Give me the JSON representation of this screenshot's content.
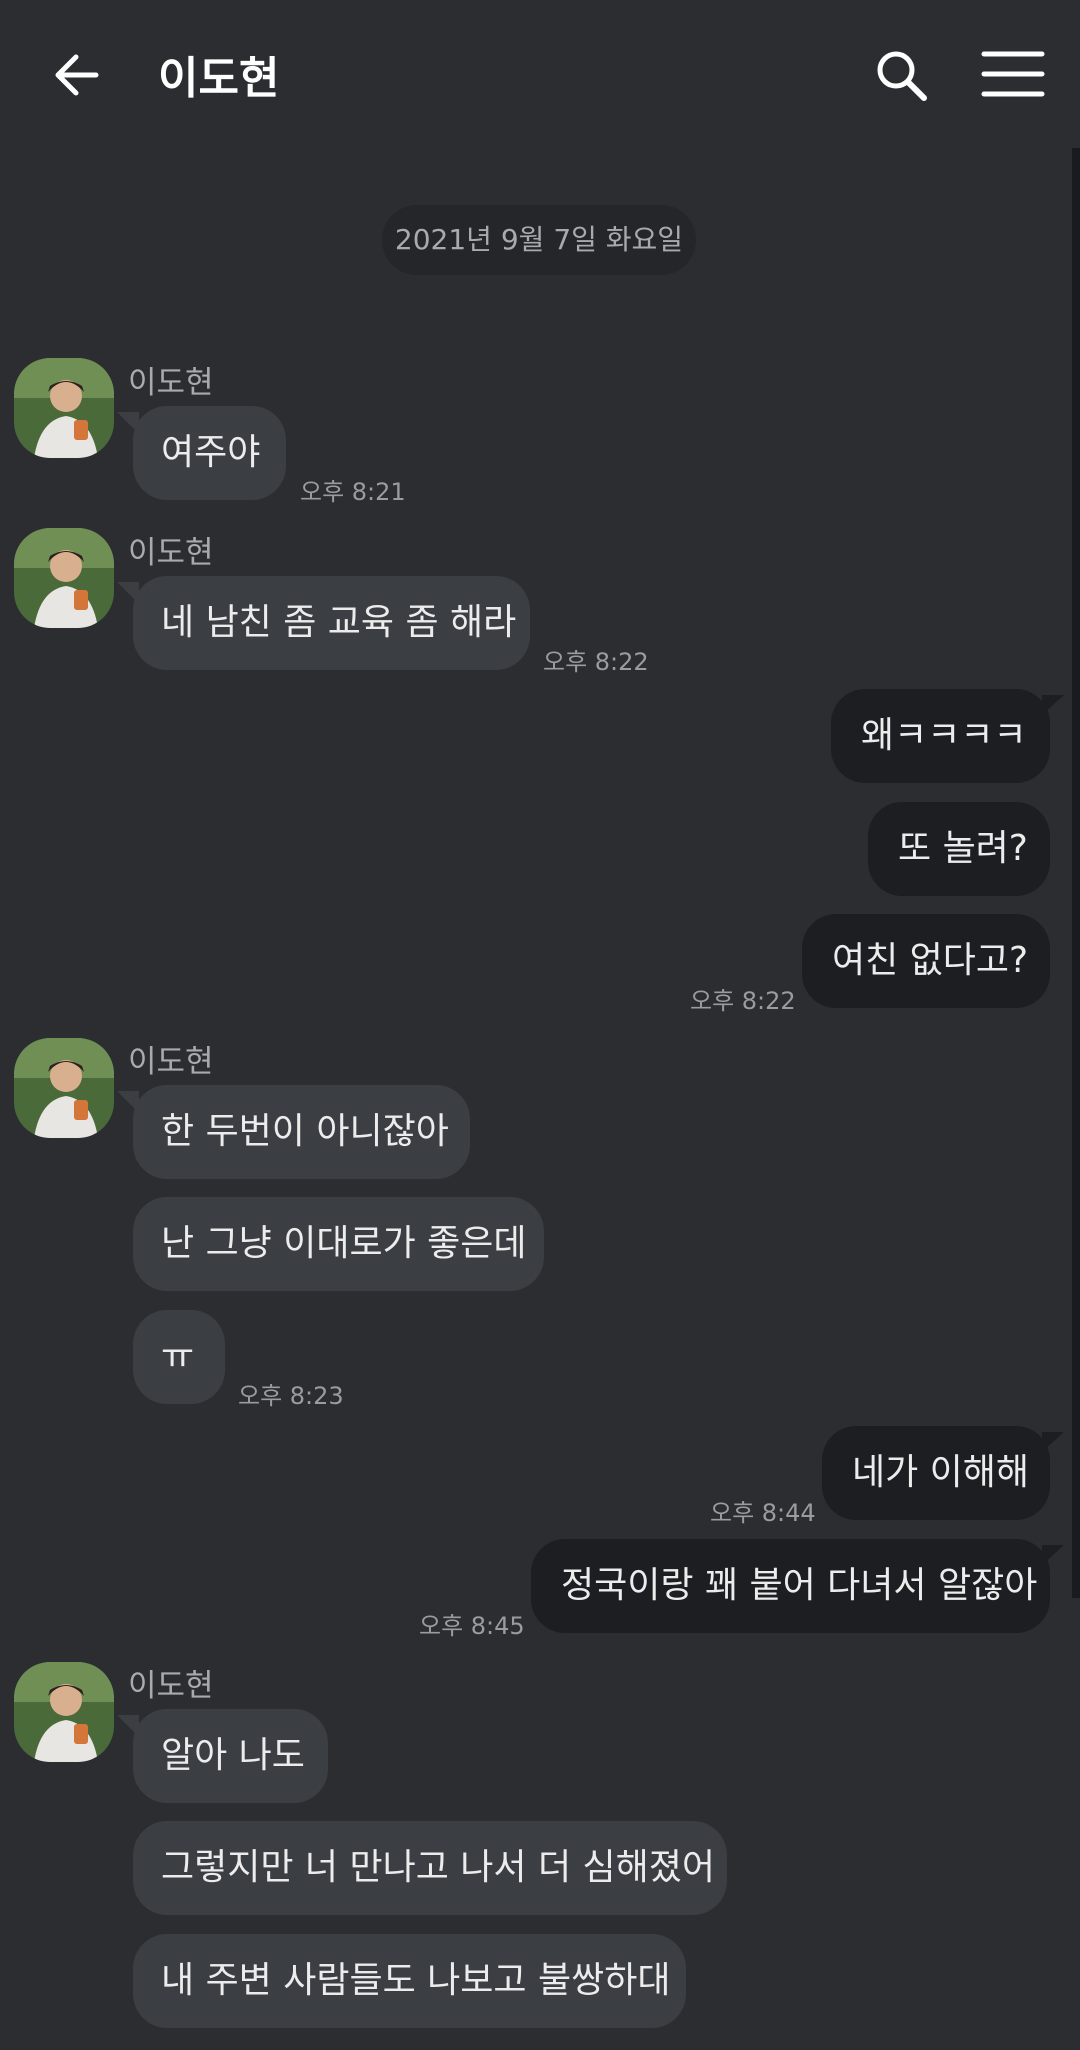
{
  "header": {
    "title": "이도현"
  },
  "date_divider": "2021년 9월 7일 화요일",
  "sender_name": "이도현",
  "messages": {
    "m1": "여주야",
    "m2": "네 남친 좀 교육 좀 해라",
    "m3": "왜ㅋㅋㅋㅋ",
    "m4": "또 놀려?",
    "m5": "여친 없다고?",
    "m6": "한 두번이 아니잖아",
    "m7": "난 그냥 이대로가 좋은데",
    "m8": "ㅠ",
    "m9": "네가 이해해",
    "m10": "정국이랑 꽤 붙어 다녀서 알잖아",
    "m11": "알아 나도",
    "m12": "그렇지만 너 만나고 나서 더 심해졌어",
    "m13": "내 주변 사람들도 나보고 불쌍하대"
  },
  "times": {
    "t1": "오후 8:21",
    "t2": "오후 8:22",
    "t3": "오후 8:22",
    "t4": "오후 8:23",
    "t5": "오후 8:44",
    "t6": "오후 8:45"
  },
  "icons": [
    "back-arrow-icon",
    "search-icon",
    "menu-icon"
  ],
  "colors": {
    "background": "#2b2d31",
    "incoming_bubble": "#3b3e43",
    "outgoing_bubble": "#1d1e21",
    "secondary_text": "#a8aaad"
  }
}
